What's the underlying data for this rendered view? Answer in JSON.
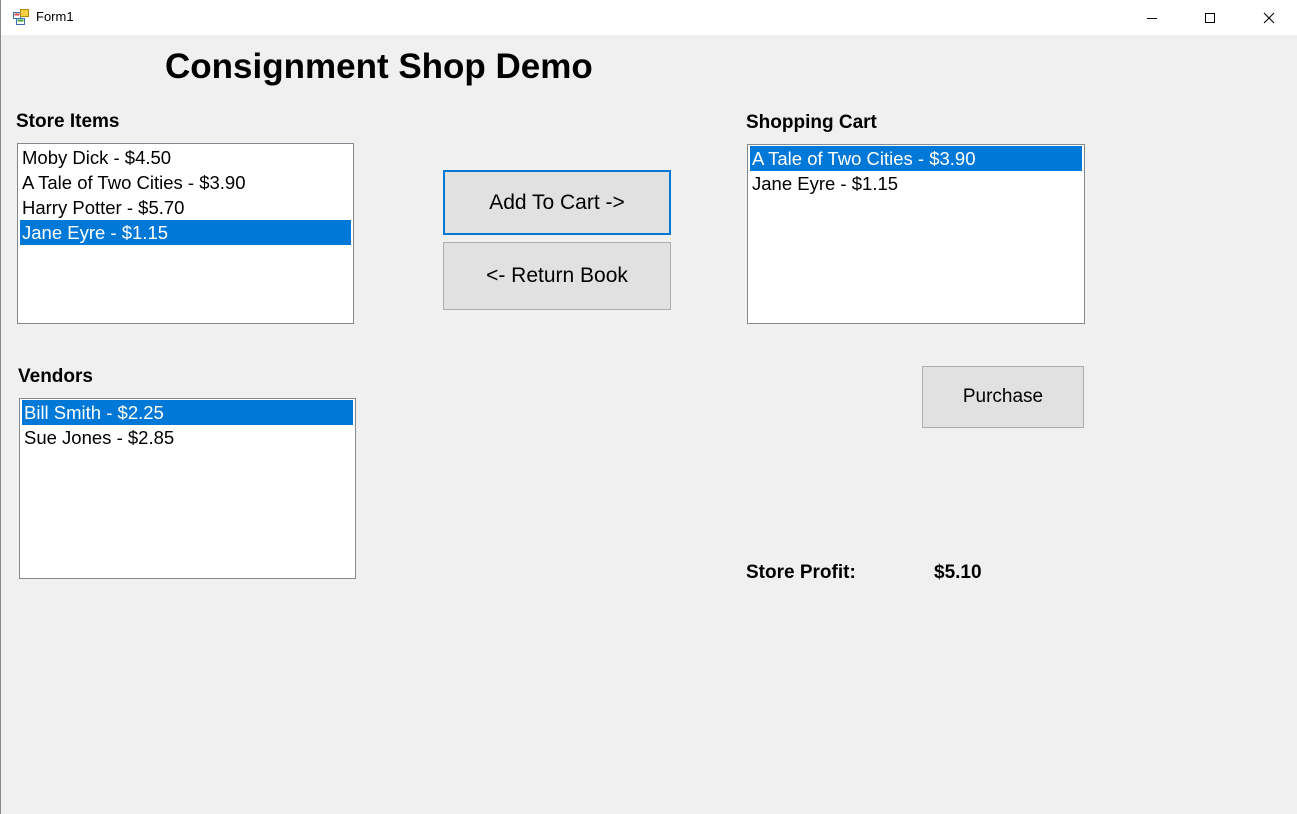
{
  "window": {
    "title": "Form1",
    "app_icon": "winforms-app-icon",
    "controls": [
      "minimize-icon",
      "maximize-icon",
      "close-icon"
    ]
  },
  "heading": "Consignment Shop Demo",
  "store_items": {
    "label": "Store Items",
    "items": [
      "Moby Dick - $4.50",
      "A Tale of Two Cities - $3.90",
      "Harry Potter - $5.70",
      "Jane Eyre - $1.15"
    ],
    "selected_index": 3
  },
  "shopping_cart": {
    "label": "Shopping Cart",
    "items": [
      "A Tale of Two Cities - $3.90",
      "Jane Eyre - $1.15"
    ],
    "selected_index": 0
  },
  "vendors": {
    "label": "Vendors",
    "items": [
      "Bill Smith - $2.25",
      "Sue Jones - $2.85"
    ],
    "selected_index": 0
  },
  "buttons": {
    "add_to_cart": "Add To Cart ->",
    "return_book": "<- Return Book",
    "purchase": "Purchase"
  },
  "profit": {
    "label": "Store Profit:",
    "value": "$5.10"
  },
  "colors": {
    "selection": "#0078d7",
    "background": "#f0f0f0",
    "button": "#e1e1e1"
  }
}
